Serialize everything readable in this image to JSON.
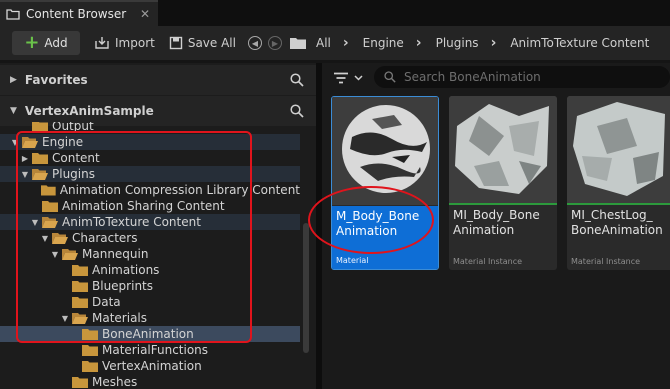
{
  "tab": {
    "title": "Content Browser",
    "close": "✕",
    "icon": "content-browser-icon"
  },
  "toolbar": {
    "add_label": "Add",
    "import_label": "Import",
    "save_all_label": "Save All",
    "breadcrumbs": [
      "All",
      "Engine",
      "Plugins",
      "AnimToTexture Content"
    ]
  },
  "favorites": {
    "label": "Favorites"
  },
  "project": {
    "label": "VertexAnimSample"
  },
  "tree": [
    {
      "label": "Output",
      "depth": 2,
      "exp": "",
      "state": ""
    },
    {
      "label": "Engine",
      "depth": 1,
      "exp": "▼",
      "state": "hl"
    },
    {
      "label": "Content",
      "depth": 2,
      "exp": "▶",
      "state": ""
    },
    {
      "label": "Plugins",
      "depth": 2,
      "exp": "▼",
      "state": "hl"
    },
    {
      "label": "Animation Compression Library Content",
      "depth": 3,
      "exp": "",
      "state": ""
    },
    {
      "label": "Animation Sharing Content",
      "depth": 3,
      "exp": "",
      "state": ""
    },
    {
      "label": "AnimToTexture Content",
      "depth": 3,
      "exp": "▼",
      "state": "hl"
    },
    {
      "label": "Characters",
      "depth": 4,
      "exp": "▼",
      "state": ""
    },
    {
      "label": "Mannequin",
      "depth": 5,
      "exp": "▼",
      "state": ""
    },
    {
      "label": "Animations",
      "depth": 6,
      "exp": "",
      "state": ""
    },
    {
      "label": "Blueprints",
      "depth": 6,
      "exp": "",
      "state": ""
    },
    {
      "label": "Data",
      "depth": 6,
      "exp": "",
      "state": ""
    },
    {
      "label": "Materials",
      "depth": 6,
      "exp": "▼",
      "state": ""
    },
    {
      "label": "BoneAnimation",
      "depth": 7,
      "exp": "",
      "state": "sel"
    },
    {
      "label": "MaterialFunctions",
      "depth": 7,
      "exp": "",
      "state": ""
    },
    {
      "label": "VertexAnimation",
      "depth": 7,
      "exp": "",
      "state": ""
    },
    {
      "label": "Meshes",
      "depth": 6,
      "exp": "",
      "state": ""
    }
  ],
  "search": {
    "placeholder": "Search BoneAnimation"
  },
  "assets": [
    {
      "name": "M_Body_Bone Animation",
      "type": "Material",
      "selected": true
    },
    {
      "name": "MI_Body_Bone Animation",
      "type": "Material Instance",
      "selected": false
    },
    {
      "name": "MI_ChestLog_ BoneAnimation",
      "type": "Material Instance",
      "selected": false
    }
  ],
  "colors": {
    "accent": "#0e6ed6",
    "folder": "#c8963c",
    "annotation": "#e0141c",
    "asset_bar": "#2c9a3c"
  }
}
